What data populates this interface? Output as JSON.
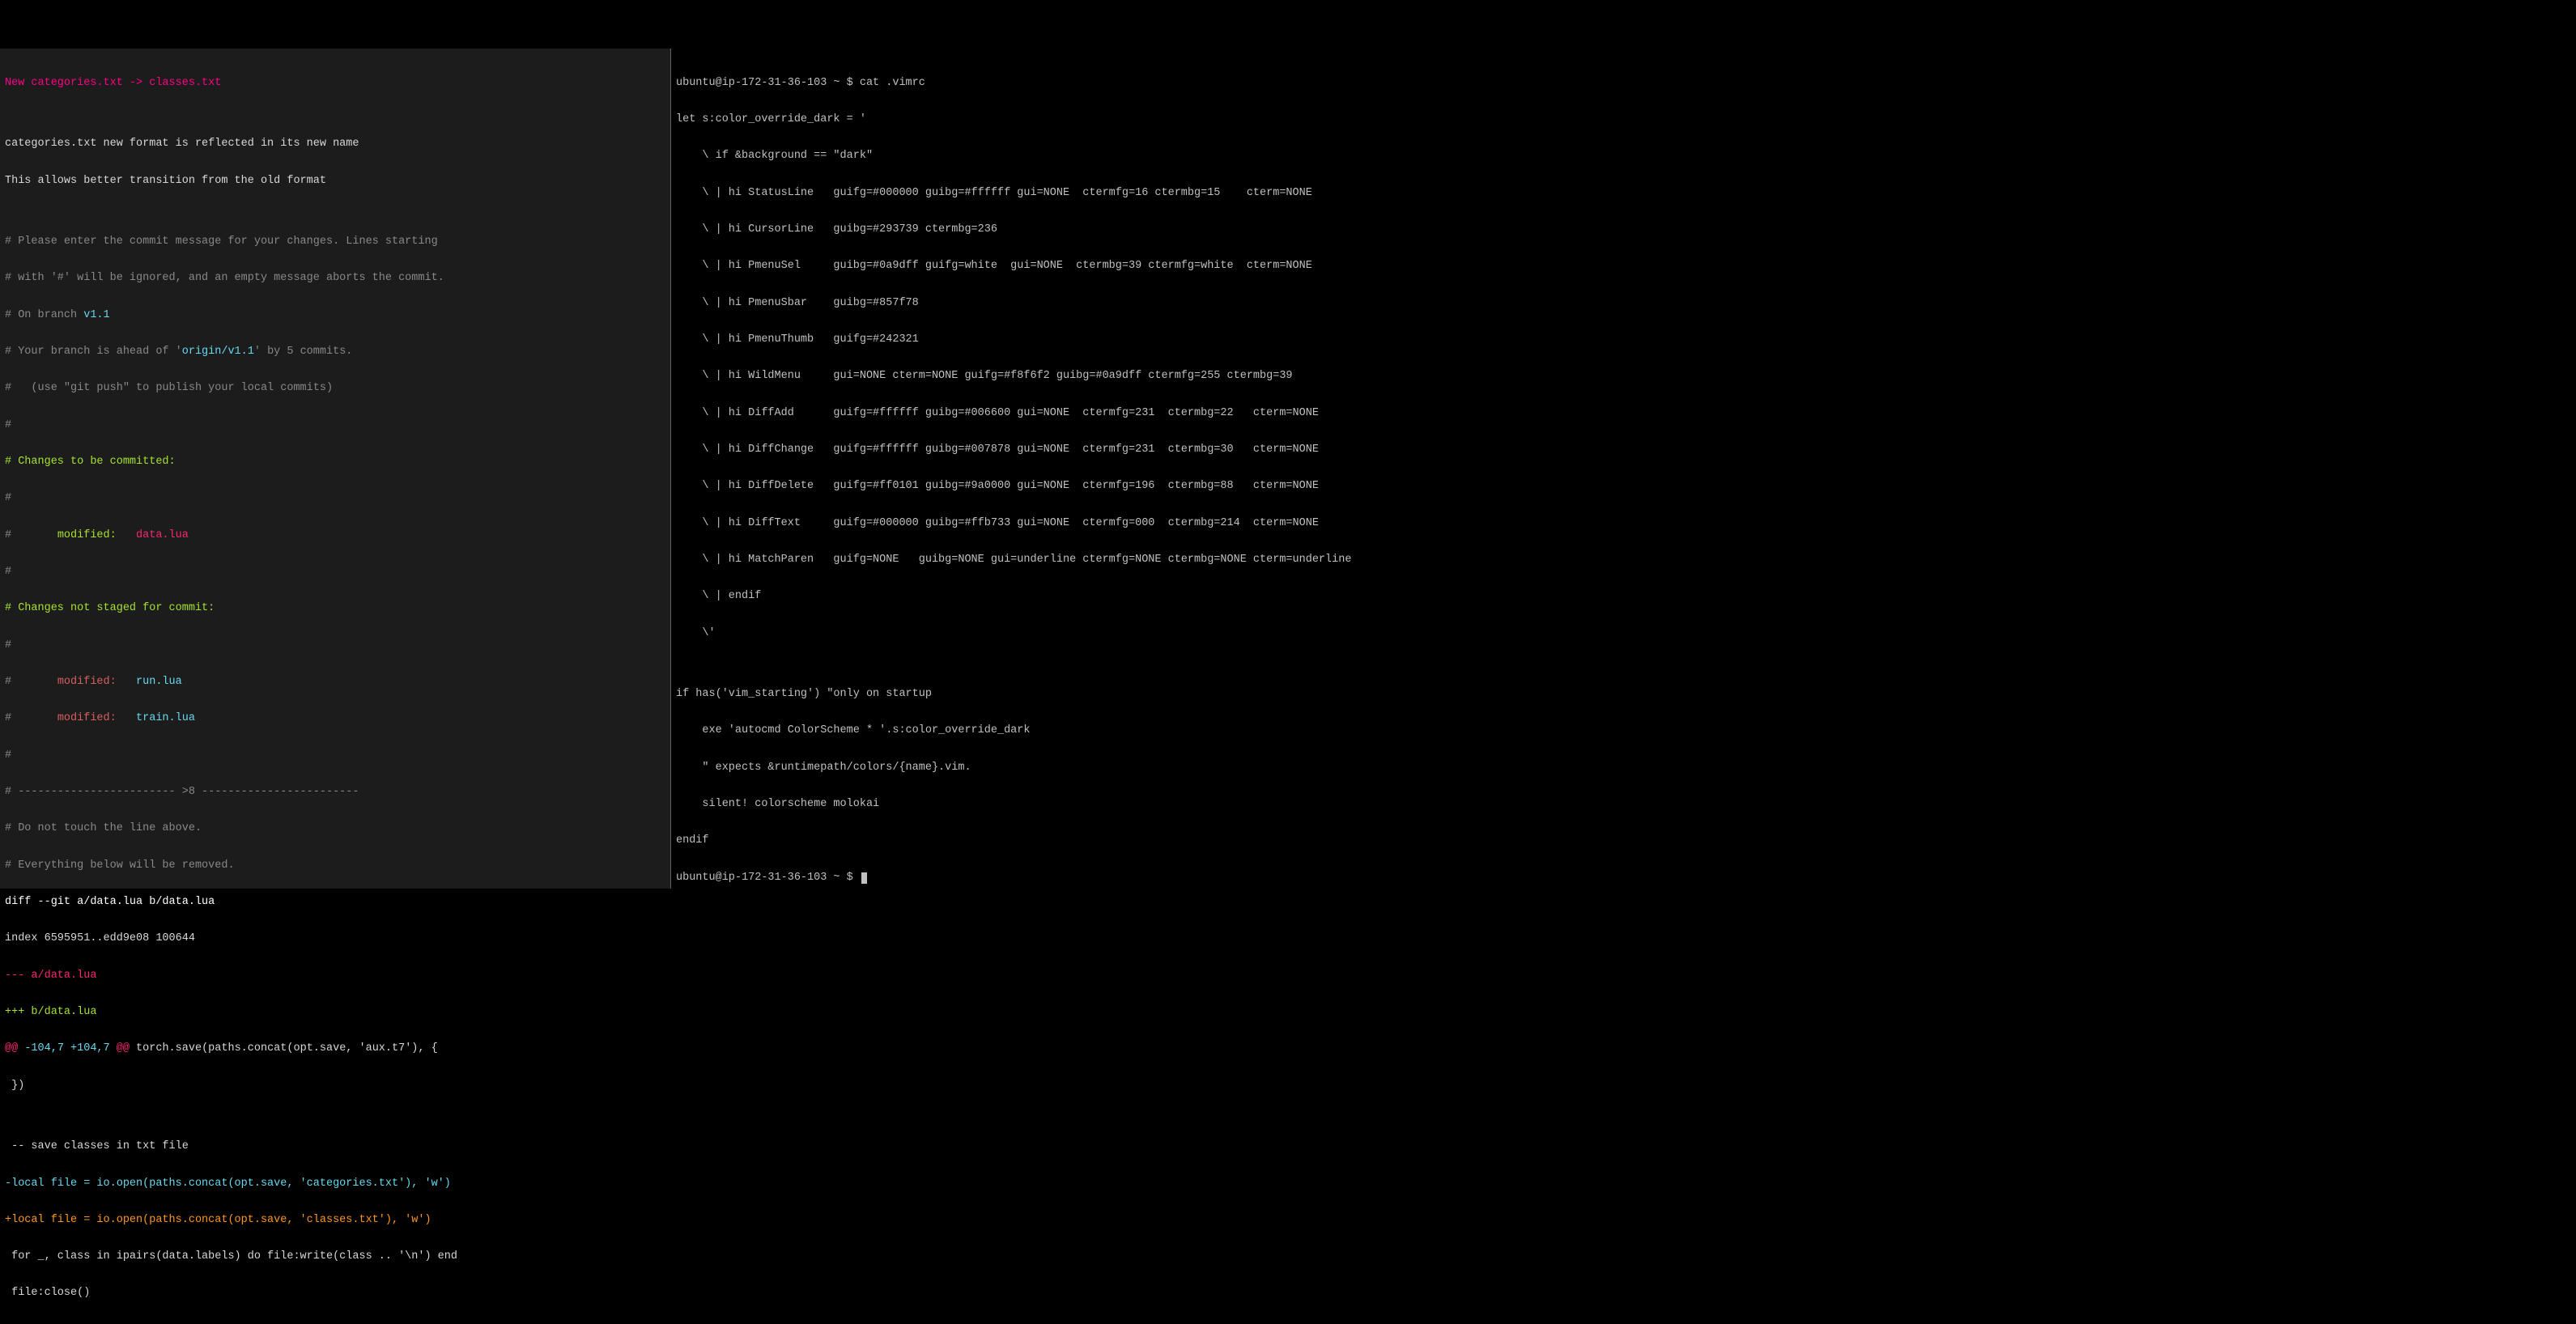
{
  "left": {
    "title": "New categories.txt -> classes.txt",
    "blank1": "",
    "desc1": "categories.txt new format is reflected in its new name",
    "desc2": "This allows better transition from the old format",
    "blank2": "",
    "c1": "# Please enter the commit message for your changes. Lines starting",
    "c2": "# with '#' will be ignored, and an empty message aborts the commit.",
    "branchPrefix": "# On branch ",
    "branchName": "v1.1",
    "aheadPrefix": "# Your branch is ahead of '",
    "aheadRef": "origin/v1.1",
    "aheadSuffix": "' by 5 commits.",
    "pushHint": "#   (use \"git push\" to publish your local commits)",
    "hash1": "#",
    "changesCommitted": "# Changes to be committed:",
    "hash2": "#",
    "modPrefixA": "#       ",
    "modLabelA": "modified:   ",
    "modFileA": "data.lua",
    "hash3": "#",
    "changesNotStaged": "# Changes not staged for commit:",
    "hash4": "#",
    "modPrefixB": "#       ",
    "modLabelB": "modified:   ",
    "modFileB": "run.lua",
    "modPrefixC": "#       ",
    "modLabelC": "modified:   ",
    "modFileC": "train.lua",
    "hash5": "#",
    "scissors": "# ------------------------ >8 ------------------------",
    "dontTouch": "# Do not touch the line above.",
    "removed": "# Everything below will be removed.",
    "diffHeader": "diff --git a/data.lua b/data.lua",
    "indexLine": "index 6595951..edd9e08 100644",
    "minusFile": "--- a/data.lua",
    "plusFile": "+++ b/data.lua",
    "hunkAt1": "@@ ",
    "hunkRange": "-104,7 +104,7",
    "hunkAt2": " @@",
    "hunkCtx": " torch.save(paths.concat(opt.save, 'aux.t7'), {",
    "ctx1": " })",
    "ctx2": "",
    "ctx3": " -- save classes in txt file",
    "diffMinus": "-local file = io.open(paths.concat(opt.save, 'categories.txt'), 'w')",
    "diffPlus": "+local file = io.open(paths.concat(opt.save, 'classes.txt'), 'w')",
    "ctx4": " for _, class in ipairs(data.labels) do file:write(class .. '\\n') end",
    "ctx5": " file:close()"
  },
  "right": {
    "r01": "ubuntu@ip-172-31-36-103 ~ $ cat .vimrc",
    "r02": "let s:color_override_dark = '",
    "r03": "    \\ if &background == \"dark\"",
    "r04": "    \\ | hi StatusLine   guifg=#000000 guibg=#ffffff gui=NONE  ctermfg=16 ctermbg=15    cterm=NONE",
    "r05": "    \\ | hi CursorLine   guibg=#293739 ctermbg=236",
    "r06": "    \\ | hi PmenuSel     guibg=#0a9dff guifg=white  gui=NONE  ctermbg=39 ctermfg=white  cterm=NONE",
    "r07": "    \\ | hi PmenuSbar    guibg=#857f78",
    "r08": "    \\ | hi PmenuThumb   guifg=#242321",
    "r09": "    \\ | hi WildMenu     gui=NONE cterm=NONE guifg=#f8f6f2 guibg=#0a9dff ctermfg=255 ctermbg=39",
    "r10": "    \\ | hi DiffAdd      guifg=#ffffff guibg=#006600 gui=NONE  ctermfg=231  ctermbg=22   cterm=NONE",
    "r11": "    \\ | hi DiffChange   guifg=#ffffff guibg=#007878 gui=NONE  ctermfg=231  ctermbg=30   cterm=NONE",
    "r12": "    \\ | hi DiffDelete   guifg=#ff0101 guibg=#9a0000 gui=NONE  ctermfg=196  ctermbg=88   cterm=NONE",
    "r13": "    \\ | hi DiffText     guifg=#000000 guibg=#ffb733 gui=NONE  ctermfg=000  ctermbg=214  cterm=NONE",
    "r14": "    \\ | hi MatchParen   guifg=NONE   guibg=NONE gui=underline ctermfg=NONE ctermbg=NONE cterm=underline",
    "r15": "    \\ | endif",
    "r16": "    \\'",
    "r17": "",
    "r18": "if has('vim_starting') \"only on startup",
    "r19": "    exe 'autocmd ColorScheme * '.s:color_override_dark",
    "r20": "    \" expects &runtimepath/colors/{name}.vim.",
    "r21": "    silent! colorscheme molokai",
    "r22": "endif",
    "r23": "ubuntu@ip-172-31-36-103 ~ $ "
  }
}
